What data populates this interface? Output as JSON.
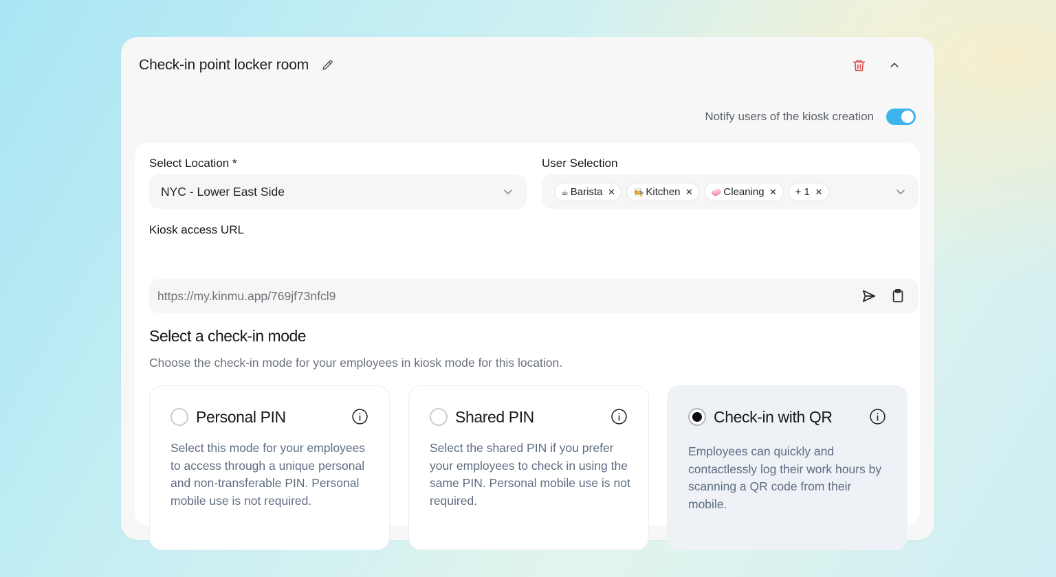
{
  "card": {
    "title": "Check-in point locker room",
    "notify_label": "Notify users of the kiosk creation",
    "notify_enabled": true
  },
  "location": {
    "label": "Select Location *",
    "value": "NYC - Lower East Side"
  },
  "users": {
    "label": "User Selection",
    "chips": [
      {
        "emoji": "☕",
        "label": "Barista"
      },
      {
        "emoji": "🧑‍🍳",
        "label": "Kitchen"
      },
      {
        "emoji": "🧼",
        "label": "Cleaning"
      },
      {
        "emoji": "",
        "label": "+ 1"
      }
    ],
    "remove_glyph": "✕"
  },
  "kiosk": {
    "label": "Kiosk access URL",
    "url": "https://my.kinmu.app/769jf73nfcl9"
  },
  "modes": {
    "title": "Select a check-in mode",
    "description": "Choose the check-in mode for your employees in kiosk mode for this location.",
    "options": [
      {
        "title": "Personal PIN",
        "description": "Select this mode for your employees to access through a unique personal and non-transferable PIN. Personal mobile use is not required.",
        "selected": false
      },
      {
        "title": "Shared PIN",
        "description": "Select the shared PIN if you prefer your employees to check in using the same PIN. Personal mobile use is not required.",
        "selected": false
      },
      {
        "title": "Check-in with QR",
        "description": "Employees can quickly and contactlessly log their work hours by scanning a QR code from their mobile.",
        "selected": true
      }
    ]
  },
  "colors": {
    "accent": "#3db4ee",
    "danger": "#e0484f",
    "selected_card": "#eef2f6"
  },
  "icons": [
    "pencil-icon",
    "trash-icon",
    "chevron-up-icon",
    "chevron-down-icon",
    "close-icon",
    "send-icon",
    "clipboard-icon",
    "info-icon"
  ]
}
